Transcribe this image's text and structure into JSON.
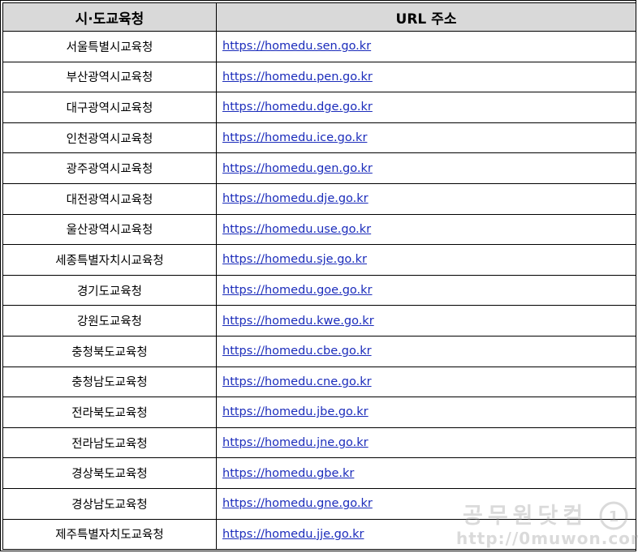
{
  "headers": {
    "col1": "시·도교육청",
    "col2": "URL 주소"
  },
  "rows": [
    {
      "name": "서울특별시교육청",
      "url": "https://homedu.sen.go.kr"
    },
    {
      "name": "부산광역시교육청",
      "url": "https://homedu.pen.go.kr"
    },
    {
      "name": "대구광역시교육청",
      "url": "https://homedu.dge.go.kr"
    },
    {
      "name": "인천광역시교육청",
      "url": "https://homedu.ice.go.kr"
    },
    {
      "name": "광주광역시교육청",
      "url": "https://homedu.gen.go.kr"
    },
    {
      "name": "대전광역시교육청",
      "url": "https://homedu.dje.go.kr"
    },
    {
      "name": "울산광역시교육청",
      "url": "https://homedu.use.go.kr"
    },
    {
      "name": "세종특별자치시교육청",
      "url": "https://homedu.sje.go.kr"
    },
    {
      "name": "경기도교육청",
      "url": "https://homedu.goe.go.kr"
    },
    {
      "name": "강원도교육청",
      "url": "https://homedu.kwe.go.kr"
    },
    {
      "name": "충청북도교육청",
      "url": "https://homedu.cbe.go.kr"
    },
    {
      "name": "충청남도교육청",
      "url": "https://homedu.cne.go.kr"
    },
    {
      "name": "전라북도교육청",
      "url": "https://homedu.jbe.go.kr"
    },
    {
      "name": "전라남도교육청",
      "url": "https://homedu.jne.go.kr"
    },
    {
      "name": "경상북도교육청",
      "url": "https://homedu.gbe.kr"
    },
    {
      "name": "경상남도교육청",
      "url": "https://homedu.gne.go.kr"
    },
    {
      "name": "제주특별자치도교육청",
      "url": "https://homedu.jje.go.kr"
    }
  ],
  "watermark": {
    "title": "공무원닷컴",
    "url": "http://0muwon.com"
  },
  "colors": {
    "header_bg": "#d9d9d9",
    "link": "#1b2cbb",
    "border": "#000000"
  }
}
